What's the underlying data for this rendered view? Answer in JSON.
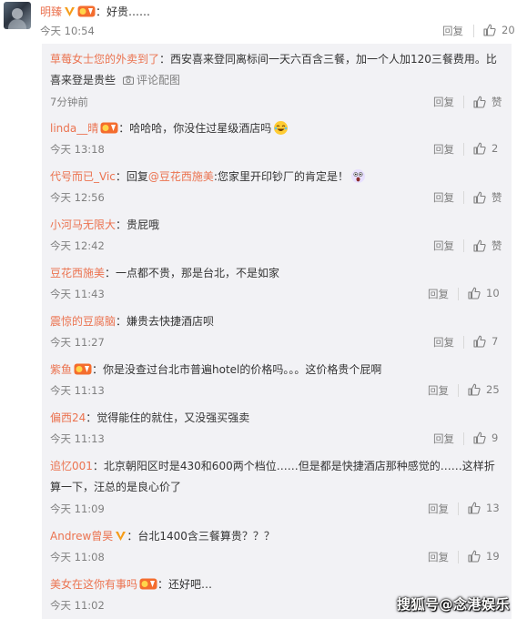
{
  "top": {
    "author": "明臻",
    "text": "：好贵……",
    "time": "今天 10:54",
    "reply_label": "回复",
    "likes": "20"
  },
  "comments": [
    {
      "name": "草莓女士您的外卖到了",
      "text": "：西安喜来登同离标间一天六百含三餐，加一个人加120三餐费用。比喜来登是贵些",
      "pic_label": "评论配图",
      "time": "7分钟前",
      "reply": "回复",
      "likes": "赞"
    },
    {
      "name": "linda__晴",
      "text": "：哈哈哈，你没住过星级酒店吗",
      "time": "今天 13:18",
      "reply": "回复",
      "likes": "2"
    },
    {
      "name": "代号而已_Vic",
      "prefix": "：回复",
      "mention": "@豆花西施美",
      "text": ":您家里开印钞厂的肯定是！",
      "time": "今天 12:56",
      "reply": "回复",
      "likes": "赞"
    },
    {
      "name": "小河马无限大",
      "text": "：贵屁哦",
      "time": "今天 12:42",
      "reply": "回复",
      "likes": "赞"
    },
    {
      "name": "豆花西施美",
      "text": "：一点都不贵，那是台北，不是如家",
      "time": "今天 11:43",
      "reply": "回复",
      "likes": "10"
    },
    {
      "name": "震惊的豆腐脑",
      "text": "：嫌贵去快捷酒店呗",
      "time": "今天 11:27",
      "reply": "回复",
      "likes": "7"
    },
    {
      "name": "紫鱼",
      "text": "：你是没查过台北市普遍hotel的价格吗。。。这价格贵个屁啊",
      "time": "今天 11:13",
      "reply": "回复",
      "likes": "25"
    },
    {
      "name": "偏西24",
      "text": "：觉得能住的就住，又没强买强卖",
      "time": "今天 11:13",
      "reply": "回复",
      "likes": "9"
    },
    {
      "name": "追忆001",
      "text": "：北京朝阳区时是430和600两个档位……但是都是快捷酒店那种感觉的……这样折算一下，汪总的是良心价了",
      "time": "今天 11:09",
      "reply": "回复",
      "likes": "13"
    },
    {
      "name": "Andrew曾昊",
      "text": "：台北1400含三餐算贵？？？",
      "time": "今天 11:08",
      "reply": "回复",
      "likes": "19"
    },
    {
      "name": "美女在这你有事吗",
      "text": "：还好吧…",
      "time": "今天 11:02",
      "reply": "",
      "likes": ""
    }
  ],
  "watermark": "搜狐号@念港娱乐",
  "colors": {
    "name": "#eb7350",
    "meta": "#808080",
    "bg": "#f2f2f5",
    "vip": "#f59d1a"
  }
}
